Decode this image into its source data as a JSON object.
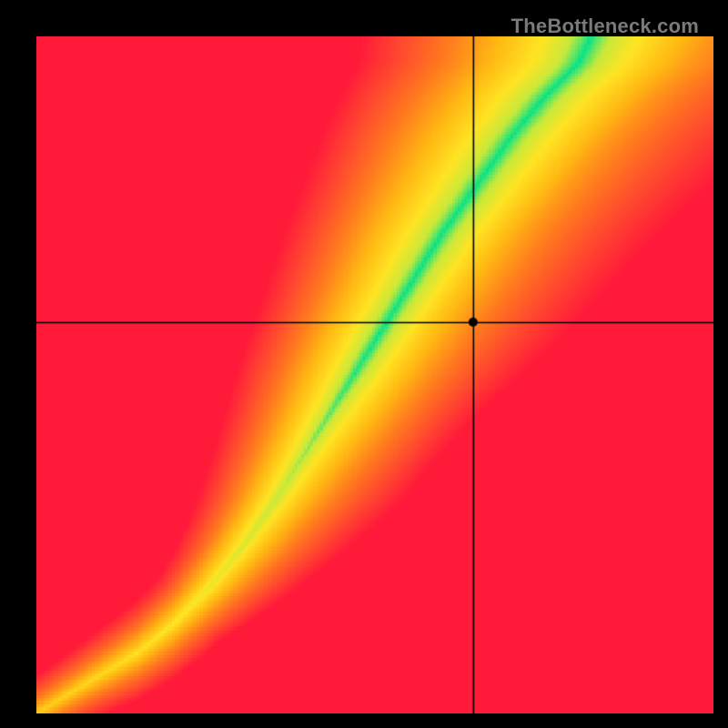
{
  "watermark": "TheBottleneck.com",
  "chart_data": {
    "type": "heatmap",
    "title": "",
    "xlabel": "",
    "ylabel": "",
    "xlim": [
      0,
      1
    ],
    "ylim": [
      0,
      1
    ],
    "crosshair": {
      "x": 0.645,
      "y": 0.578
    },
    "marker": {
      "x": 0.645,
      "y": 0.578,
      "radius": 5,
      "color": "#000000"
    },
    "ideal_curve": {
      "description": "Green optimal ridge; points (x_norm, y_norm) from bottom-left to top-right",
      "points": [
        [
          0.0,
          0.0
        ],
        [
          0.05,
          0.03
        ],
        [
          0.1,
          0.06
        ],
        [
          0.15,
          0.09
        ],
        [
          0.2,
          0.13
        ],
        [
          0.25,
          0.18
        ],
        [
          0.3,
          0.24
        ],
        [
          0.35,
          0.31
        ],
        [
          0.4,
          0.39
        ],
        [
          0.45,
          0.47
        ],
        [
          0.5,
          0.55
        ],
        [
          0.55,
          0.63
        ],
        [
          0.6,
          0.71
        ],
        [
          0.65,
          0.78
        ],
        [
          0.7,
          0.85
        ],
        [
          0.75,
          0.91
        ],
        [
          0.8,
          0.96
        ],
        [
          0.82,
          1.0
        ]
      ]
    },
    "gradient_stops": [
      {
        "t": 0.0,
        "color": "#00e28a"
      },
      {
        "t": 0.12,
        "color": "#c8e93a"
      },
      {
        "t": 0.26,
        "color": "#ffe423"
      },
      {
        "t": 0.45,
        "color": "#ffb813"
      },
      {
        "t": 0.65,
        "color": "#ff7a1e"
      },
      {
        "t": 0.82,
        "color": "#ff4b2e"
      },
      {
        "t": 1.0,
        "color": "#ff1a3a"
      }
    ],
    "resolution": 220
  }
}
